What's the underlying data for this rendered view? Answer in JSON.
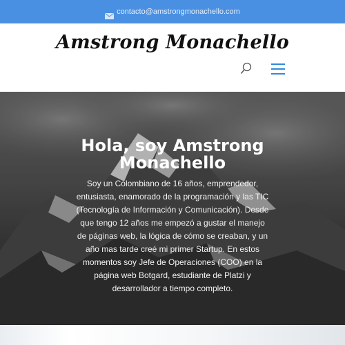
{
  "topbar": {
    "email": "contacto@amstrongmonachello.com",
    "icon": "envelope-icon",
    "background": "#4a90e2"
  },
  "header": {
    "logo_text": "Amstrong Monachello",
    "search_icon": "search-icon",
    "menu_icon": "hamburger-menu-icon",
    "accent": "#2e8ad9"
  },
  "hero": {
    "title_line1": "Hola, soy Amstrong",
    "title_line2": "Monachello",
    "bio": "Soy un Colombiano de 16 años, emprendedor, entusiasta, enamorado de la programación y las TIC (Tecnología de Información y Comunicación). Desde que tengo 12 años me empezó a gustar el manejo de páginas web, la lógica de cómo se creaban, y un año mas tarde creé mi primer Startup. En estos momentos soy Jefe de Operaciones (COO) en la página web Botgard, estudiante de Platzi y desarrollador a tiempo completo."
  }
}
